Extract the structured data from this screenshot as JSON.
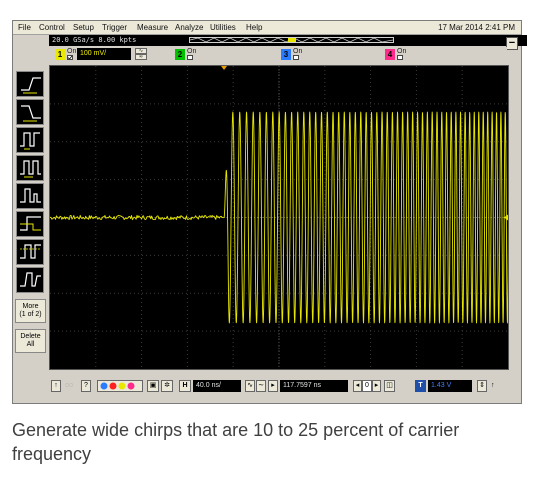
{
  "menu": {
    "items": [
      "File",
      "Control",
      "Setup",
      "Trigger",
      "Measure",
      "Analyze",
      "Utilities",
      "Help"
    ],
    "datetime": "17 Mar 2014  2:41 PM"
  },
  "acquisition": {
    "text": "20.0 GSa/s   8.00 kpts"
  },
  "channels": [
    {
      "num": "1",
      "state": "On",
      "checked": true,
      "color": "#e8e800",
      "scale": "100 mV/"
    },
    {
      "num": "2",
      "state": "On",
      "checked": false,
      "color": "#00c000"
    },
    {
      "num": "3",
      "state": "On",
      "checked": false,
      "color": "#2a7bff"
    },
    {
      "num": "4",
      "state": "On",
      "checked": false,
      "color": "#ff2a8a"
    }
  ],
  "sidebar": {
    "tools": [
      "edge-trigger-rising-icon",
      "edge-trigger-falling-icon",
      "pulse-width-trigger-icon",
      "pulse-period-trigger-icon",
      "runt-trigger-icon",
      "setup-hold-trigger-icon",
      "window-trigger-icon",
      "transition-trigger-icon"
    ],
    "more_label": "More",
    "more_sub": "(1 of 2)",
    "delete_line1": "Delete",
    "delete_line2": "All"
  },
  "bottom": {
    "timebase": "40.0 ns/",
    "position": "117.7597 ns",
    "zoom_num": "0",
    "trig_level": "1.43 V"
  },
  "waveform": {
    "color": "#e6e600",
    "burst_start_ns": -48,
    "burst_end_ns": 230,
    "amplitude_mV": 290,
    "start_period_ns": 6.2,
    "end_period_ns": 3.6
  },
  "caption": "Generate wide chirps that are 10 to 25 percent of carrier frequency"
}
